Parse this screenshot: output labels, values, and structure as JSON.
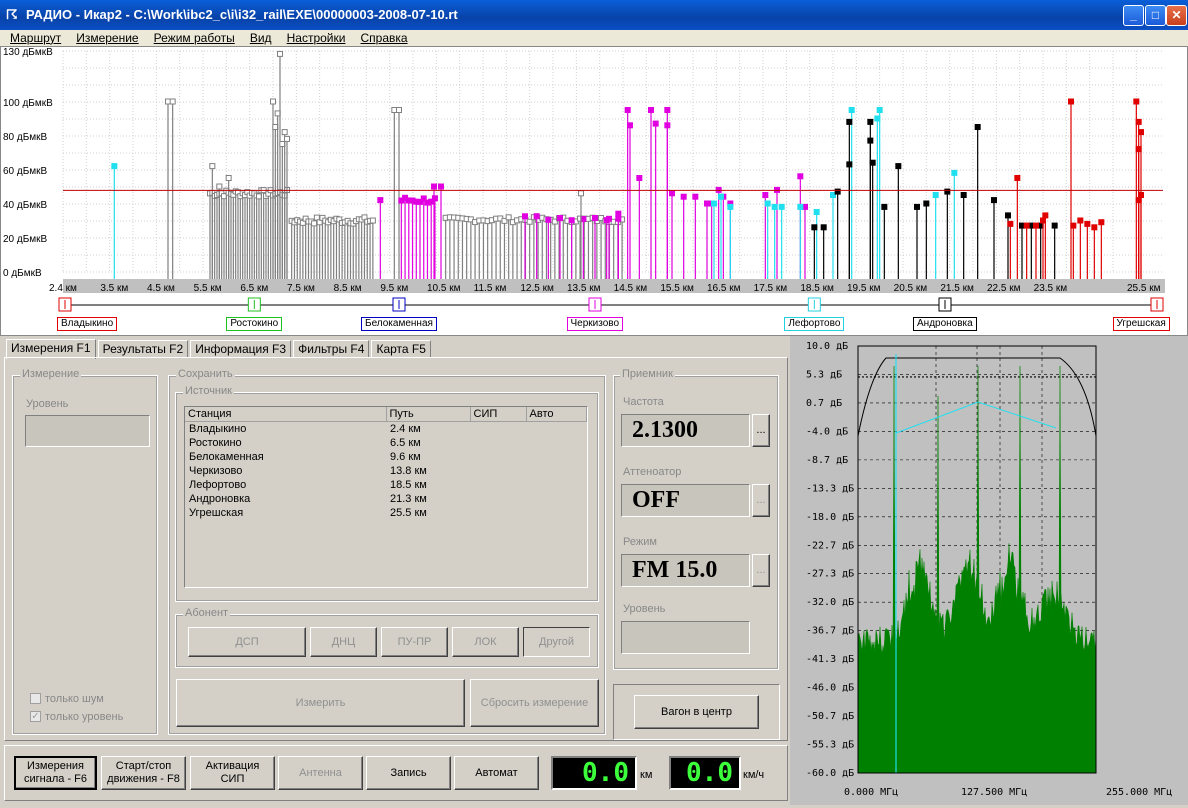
{
  "window": {
    "title": "РАДИО - Икар2 - C:\\Work\\ibc2_c\\i\\i32_rail\\EXE\\00000003-2008-07-10.rt",
    "min": "_",
    "max": "□",
    "close": "✕"
  },
  "menu": [
    "Маршрут",
    "Измерение",
    "Режим работы",
    "Вид",
    "Настройки",
    "Справка"
  ],
  "topgraph": {
    "y_ticks": [
      "130 дБмкВ",
      "100 дБмкВ",
      "80 дБмкВ",
      "60 дБмкВ",
      "40 дБмкВ",
      "20 дБмкВ",
      "0 дБмкВ"
    ],
    "y_values": [
      130,
      100,
      80,
      60,
      40,
      20,
      0
    ],
    "x_ticks": [
      "2.4 км",
      "3.5 км",
      "4.5 км",
      "5.5 км",
      "6.5 км",
      "7.5 км",
      "8.5 км",
      "9.5 км",
      "10.5 км",
      "11.5 км",
      "12.5 км",
      "13.5 км",
      "14.5 км",
      "15.5 км",
      "16.5 км",
      "17.5 км",
      "18.5 км",
      "19.5 км",
      "20.5 км",
      "21.5 км",
      "22.5 км",
      "23.5 км",
      "25.5 км"
    ],
    "x_values": [
      2.4,
      3.5,
      4.5,
      5.5,
      6.5,
      7.5,
      8.5,
      9.5,
      10.5,
      11.5,
      12.5,
      13.5,
      14.5,
      15.5,
      16.5,
      17.5,
      18.5,
      19.5,
      20.5,
      21.5,
      22.5,
      23.5,
      25.5
    ],
    "threshold": 48,
    "colors": {
      "threshold": "#c00000",
      "gray": "#808080",
      "magenta": "#e000e0",
      "cyan": "#20e0f0",
      "black": "#000000",
      "red": "#e00000",
      "green": "#20c040"
    }
  },
  "stations": [
    {
      "name": "Владыкино",
      "km": 2.4,
      "color": "#e00000"
    },
    {
      "name": "Ростокино",
      "km": 6.5,
      "color": "#20c020"
    },
    {
      "name": "Белокаменная",
      "km": 9.6,
      "color": "#0000c0"
    },
    {
      "name": "Черкизово",
      "km": 13.8,
      "color": "#e000e0"
    },
    {
      "name": "Лефортово",
      "km": 18.5,
      "color": "#20d0e0"
    },
    {
      "name": "Андроновка",
      "km": 21.3,
      "color": "#000000"
    },
    {
      "name": "Угрешская",
      "km": 25.5,
      "color": "#e00000"
    }
  ],
  "tabs": [
    "Измерения F1",
    "Результаты F2",
    "Информация F3",
    "Фильтры F4",
    "Карта F5"
  ],
  "measure": {
    "group": "Измерение",
    "level_label": "Уровень",
    "only_noise": "только шум",
    "only_level": "только уровень"
  },
  "save": {
    "group": "Сохранить",
    "source": "Источник",
    "columns": [
      "Станция",
      "Путь",
      "СИП",
      "Авто"
    ],
    "rows": [
      [
        "Владыкино",
        "2.4 км"
      ],
      [
        "Ростокино",
        "6.5 км"
      ],
      [
        "Белокаменная",
        "9.6 км"
      ],
      [
        "Черкизово",
        "13.8 км"
      ],
      [
        "Лефортово",
        "18.5 км"
      ],
      [
        "Андроновка",
        "21.3 км"
      ],
      [
        "Угрешская",
        "25.5 км"
      ]
    ],
    "subscriber": "Абонент",
    "sub_buttons": [
      "ДСП",
      "ДНЦ",
      "ПУ-ПР",
      "ЛОК",
      "Другой"
    ],
    "measure_btn": "Измерить",
    "reset_btn": "Сбросить измерение"
  },
  "receiver": {
    "group": "Приемник",
    "freq_label": "Частота",
    "freq": "2.1300",
    "att_label": "Аттеноатор",
    "att": "OFF",
    "mode_label": "Режим",
    "mode": "FM 15.0",
    "level_label": "Уровень",
    "dots": "...",
    "center_btn": "Вагон в центр"
  },
  "bottom": {
    "buttons": [
      "Измерения\nсигнала - F6",
      "Старт/стоп\nдвижения - F8",
      "Активация\nСИП",
      "Антенна",
      "Запись",
      "Автомат"
    ],
    "km_val": "0.0",
    "km_unit": "км",
    "speed_val": "0.0",
    "speed_unit": "км/ч"
  },
  "spectrum": {
    "y_ticks": [
      "10.0 дБ",
      "5.3 дБ",
      "0.7 дБ",
      "-4.0 дБ",
      "-8.7 дБ",
      "-13.3 дБ",
      "-18.0 дБ",
      "-22.7 дБ",
      "-27.3 дБ",
      "-32.0 дБ",
      "-36.7 дБ",
      "-41.3 дБ",
      "-46.0 дБ",
      "-50.7 дБ",
      "-55.3 дБ",
      "-60.0 дБ"
    ],
    "x_ticks": [
      "0.000 МГц",
      "127.500 МГц",
      "255.000 МГц"
    ],
    "colors": {
      "fill": "#008000",
      "marker": "#20e0f0",
      "grid": "#000000",
      "bg": "#c0c0c0"
    }
  }
}
